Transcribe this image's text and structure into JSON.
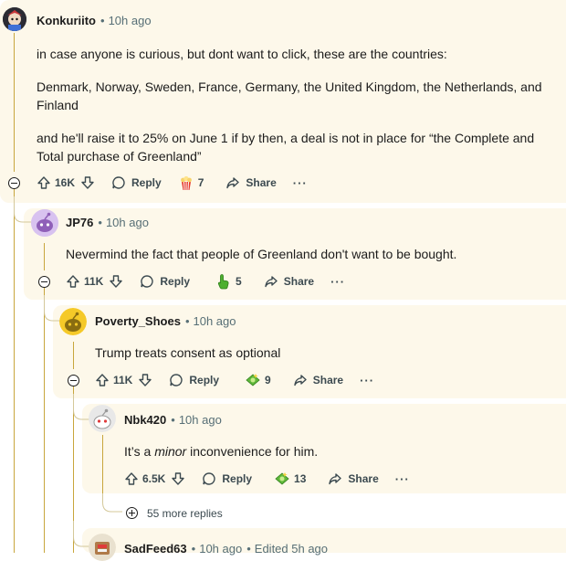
{
  "comments": [
    {
      "username": "Konkuriito",
      "time": "10h ago",
      "paragraphs": [
        "in case anyone is curious, but dont want to click, these are the countries:",
        "Denmark, Norway, Sweden, France, Germany, the United Kingdom, the Netherlands, and Finland",
        "and he'll raise it to 25% on June 1 if by then, a deal is not in place for “the Complete and Total purchase of Greenland”"
      ],
      "votes": "16K",
      "award_count": "7",
      "award_icon": "popcorn-icon",
      "reply_label": "Reply",
      "share_label": "Share"
    },
    {
      "username": "JP76",
      "time": "10h ago",
      "text": "Nevermind the fact that people of Greenland don't want to be bought.",
      "votes": "11K",
      "award_count": "5",
      "award_icon": "pointing-hand-icon",
      "reply_label": "Reply",
      "share_label": "Share"
    },
    {
      "username": "Poverty_Shoes",
      "time": "10h ago",
      "text": "Trump treats consent as optional",
      "votes": "11K",
      "award_count": "9",
      "award_icon": "money-icon",
      "reply_label": "Reply",
      "share_label": "Share"
    },
    {
      "username": "Nbk420",
      "time": "10h ago",
      "text_before": "It’s a ",
      "text_em": "minor",
      "text_after": " inconvenience for him.",
      "votes": "6.5K",
      "award_count": "13",
      "award_icon": "money-icon",
      "reply_label": "Reply",
      "share_label": "Share"
    }
  ],
  "more_replies": "55 more replies",
  "next_comment": {
    "username": "SadFeed63",
    "time": "10h ago",
    "edited": "Edited 5h ago"
  },
  "colors": {
    "highlight_bg": "#fdf8ea",
    "thread_line": "#c8a63c",
    "meta_text": "#576f76"
  }
}
